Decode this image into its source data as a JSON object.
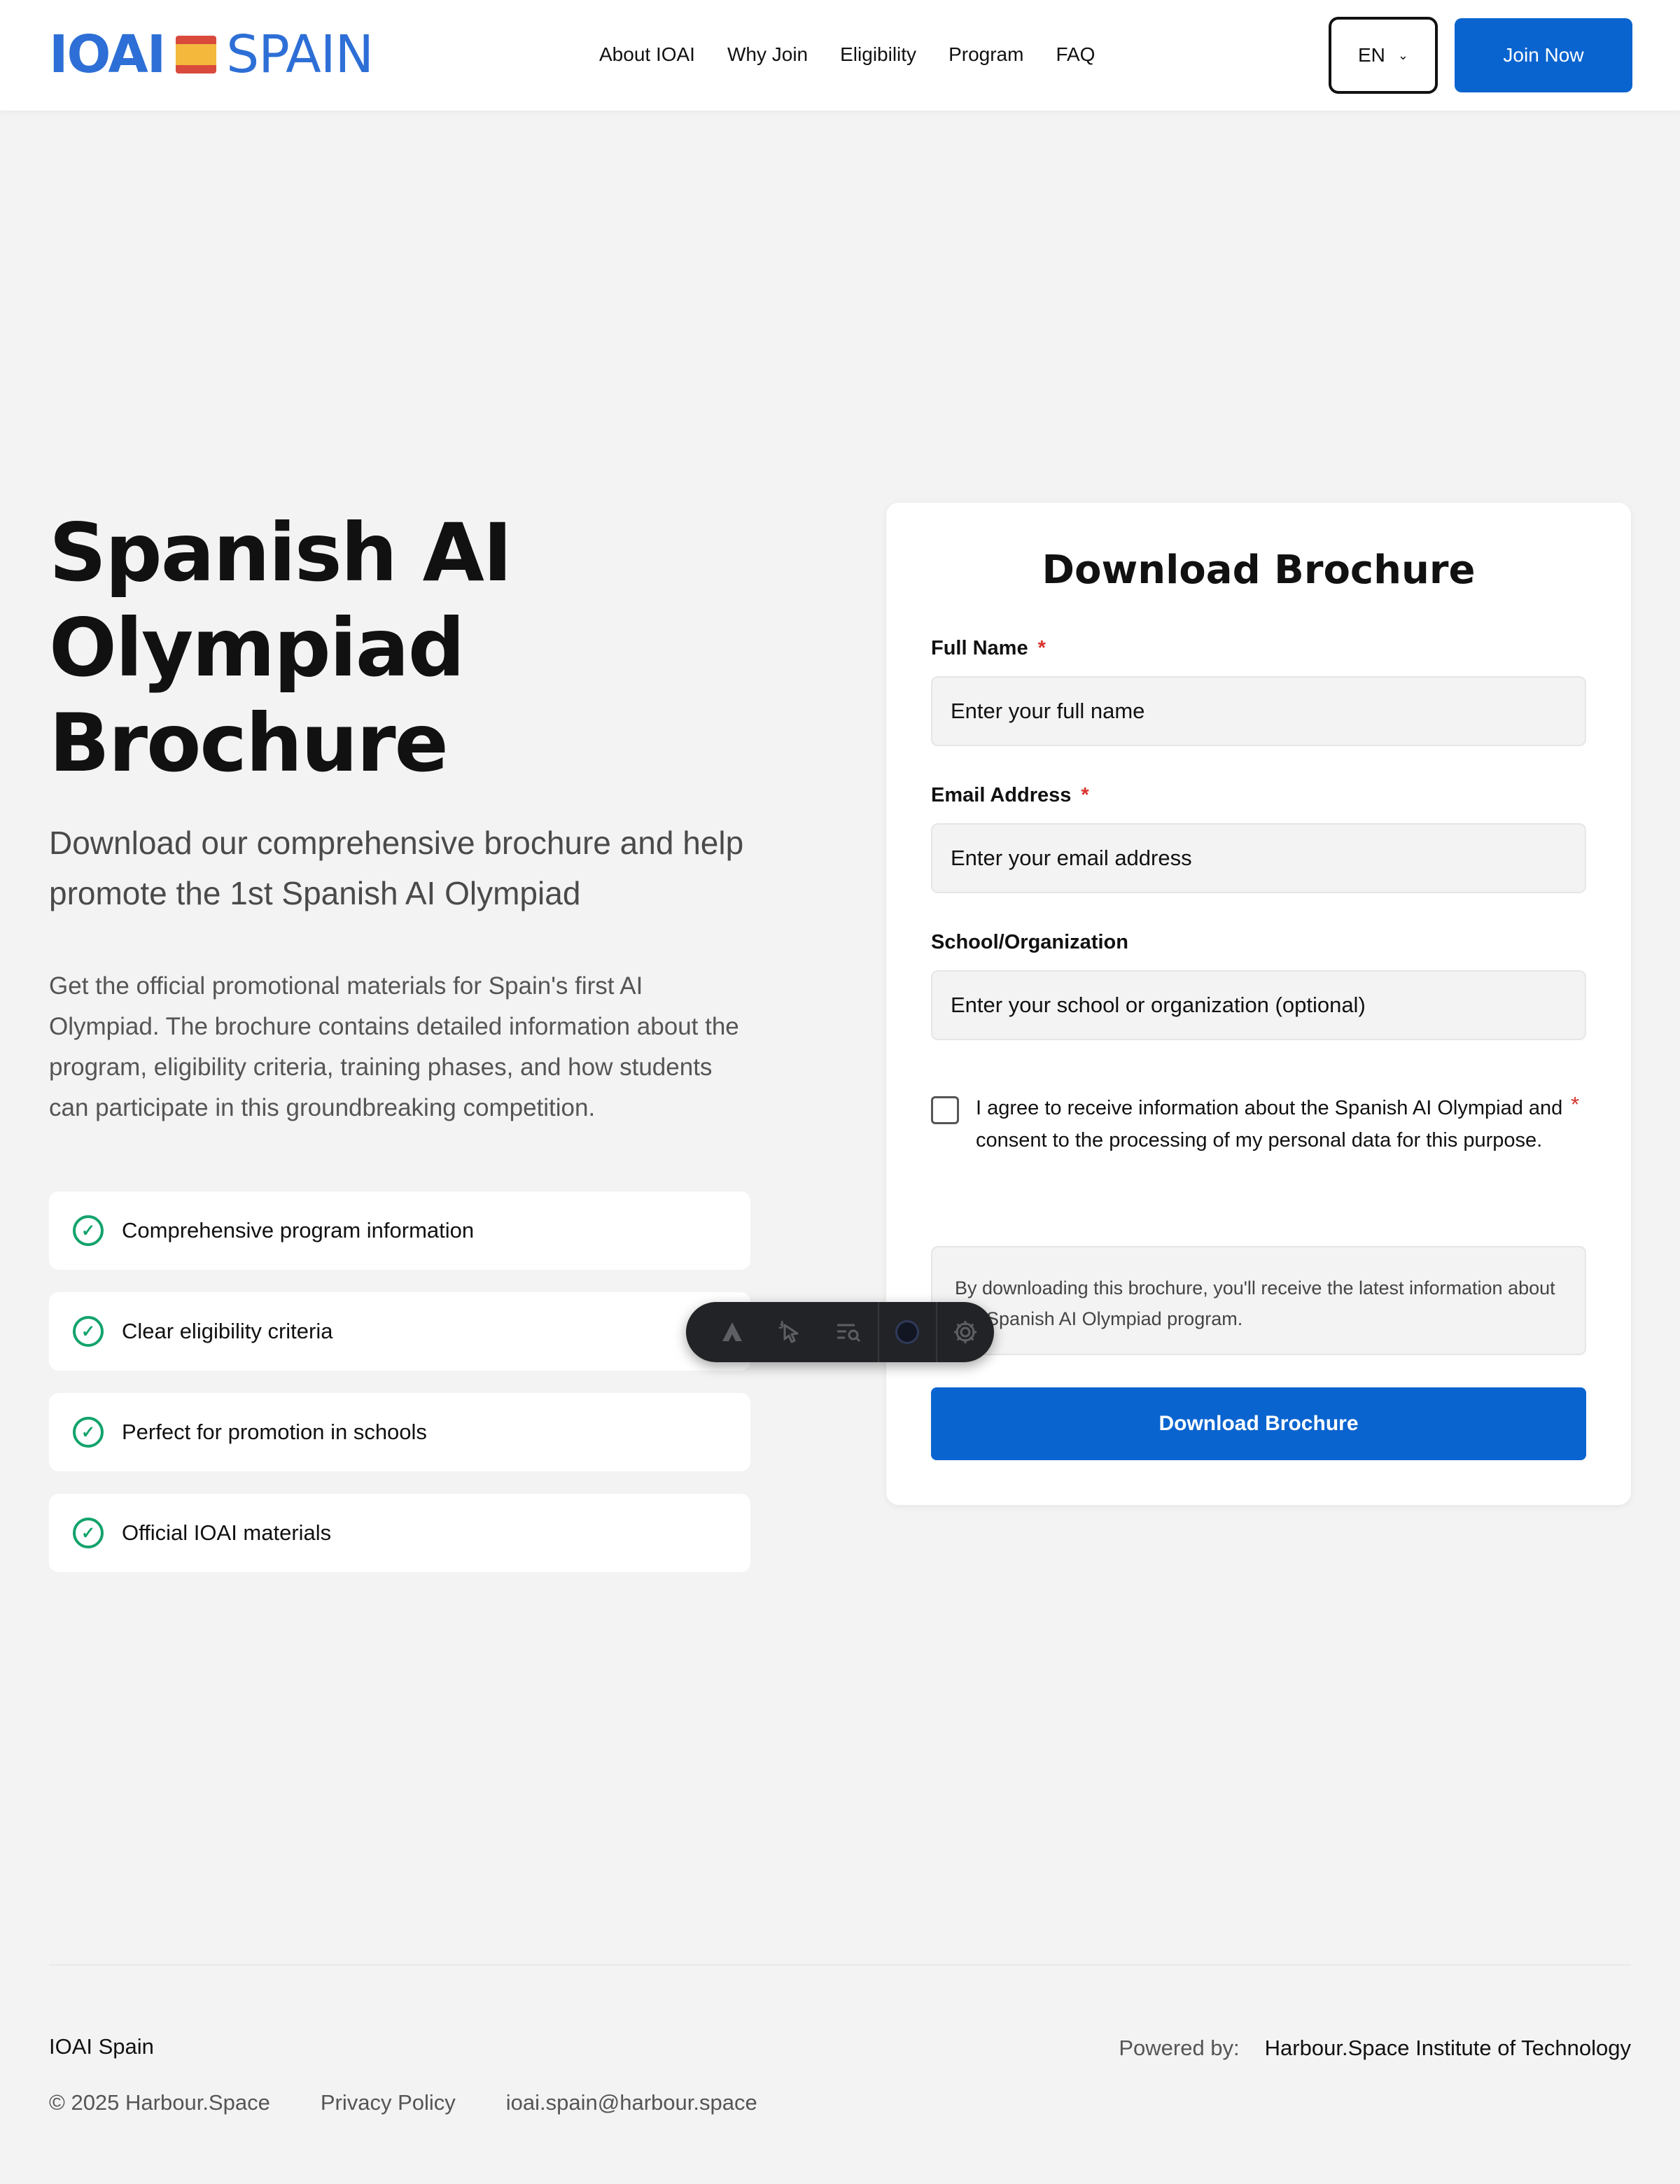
{
  "header": {
    "logo_left": "IOAI",
    "logo_right": "SPAIN",
    "nav": [
      "About IOAI",
      "Why Join",
      "Eligibility",
      "Program",
      "FAQ"
    ],
    "lang": "EN",
    "join": "Join Now"
  },
  "hero": {
    "title_lines": [
      "Spanish AI",
      "Olympiad",
      "Brochure"
    ],
    "subtitle": "Download our comprehensive brochure and help promote the 1st Spanish AI Olympiad",
    "description": "Get the official promotional materials for Spain's first AI Olympiad. The brochure contains detailed information about the program, eligibility criteria, training phases, and how students can participate in this groundbreaking competition.",
    "features": [
      "Comprehensive program information",
      "Clear eligibility criteria",
      "Perfect for promotion in schools",
      "Official IOAI materials"
    ]
  },
  "form": {
    "title": "Download Brochure",
    "full_name_label": "Full Name",
    "full_name_placeholder": "Enter your full name",
    "email_label": "Email Address",
    "email_placeholder": "Enter your email address",
    "school_label": "School/Organization",
    "school_placeholder": "Enter your school or organization (optional)",
    "required_mark": "*",
    "consent_text": "I agree to receive information about the Spanish AI Olympiad and consent to the processing of my personal data for this purpose.",
    "note": "By downloading this brochure, you'll receive the latest information about the Spanish AI Olympiad program.",
    "submit": "Download Brochure"
  },
  "footer": {
    "brand": "IOAI Spain",
    "copyright": "© 2025 Harbour.Space",
    "privacy": "Privacy Policy",
    "email": "ioai.spain@harbour.space",
    "powered_label": "Powered by:",
    "powered_name": "Harbour.Space Institute of Technology"
  },
  "colors": {
    "brand_blue": "#2d6fd6",
    "button_blue": "#0a64cf",
    "check_green": "#12a36b",
    "required_red": "#d8322b"
  }
}
